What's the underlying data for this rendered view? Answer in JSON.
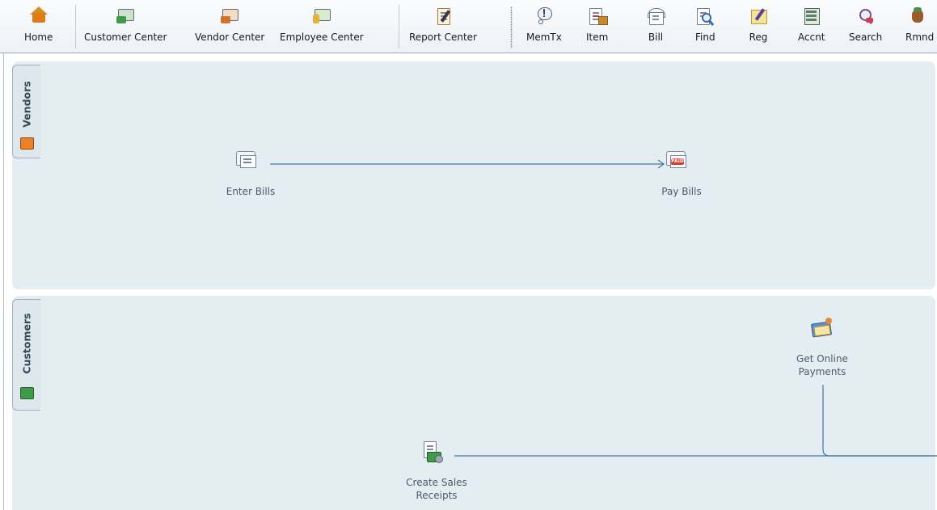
{
  "toolbar": {
    "buttons": [
      {
        "label": "Home",
        "icon": "home-icon"
      },
      {
        "label": "Customer Center",
        "icon": "customer-center-icon"
      },
      {
        "label": "Vendor Center",
        "icon": "vendor-center-icon"
      },
      {
        "label": "Employee Center",
        "icon": "employee-center-icon"
      },
      {
        "label": "Report Center",
        "icon": "report-center-icon"
      },
      {
        "label": "MemTx",
        "icon": "memorized-transactions-icon"
      },
      {
        "label": "Item",
        "icon": "item-icon"
      },
      {
        "label": "Bill",
        "icon": "bill-icon"
      },
      {
        "label": "Find",
        "icon": "find-icon"
      },
      {
        "label": "Reg",
        "icon": "register-icon"
      },
      {
        "label": "Accnt",
        "icon": "accounts-icon"
      },
      {
        "label": "Search",
        "icon": "search-icon"
      },
      {
        "label": "Rmnd",
        "icon": "reminders-icon"
      }
    ]
  },
  "sections": {
    "vendors": {
      "tab_label": "Vendors",
      "items": {
        "enter_bills": "Enter Bills",
        "pay_bills": "Pay Bills"
      }
    },
    "customers": {
      "tab_label": "Customers",
      "items": {
        "get_online_payments": "Get Online Payments",
        "create_sales_receipts": "Create Sales Receipts"
      }
    }
  },
  "colors": {
    "panel_bg": "#e4eef2",
    "flow_line": "#3f78a0",
    "label_text": "#4a5b70",
    "tab_text": "#34495a"
  }
}
